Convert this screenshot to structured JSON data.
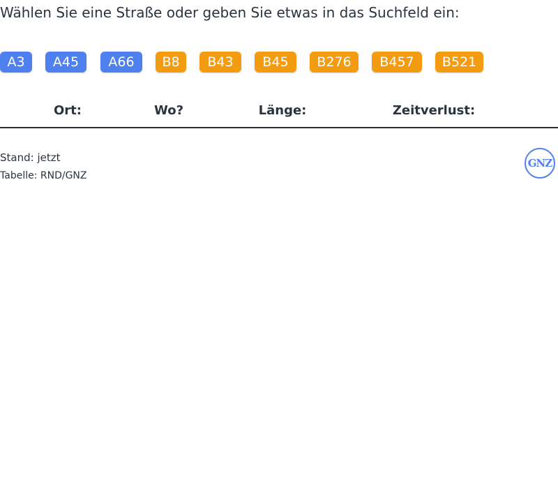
{
  "prompt": "Wählen Sie eine Straße oder geben Sie etwas in das Suchfeld ein:",
  "roads": [
    {
      "label": "A3",
      "type": "autobahn"
    },
    {
      "label": "A45",
      "type": "autobahn"
    },
    {
      "label": "A66",
      "type": "autobahn"
    },
    {
      "label": "B8",
      "type": "bundesstrasse"
    },
    {
      "label": "B43",
      "type": "bundesstrasse"
    },
    {
      "label": "B45",
      "type": "bundesstrasse"
    },
    {
      "label": "B276",
      "type": "bundesstrasse"
    },
    {
      "label": "B457",
      "type": "bundesstrasse"
    },
    {
      "label": "B521",
      "type": "bundesstrasse"
    }
  ],
  "table": {
    "columns": [
      "Ort:",
      "Wo?",
      "Länge:",
      "Zeitverlust:"
    ]
  },
  "footer": {
    "stand": "Stand: jetzt",
    "source": "Tabelle: RND/GNZ"
  },
  "logo": {
    "text": "GNZ"
  },
  "colors": {
    "autobahn": "#4f80f0",
    "bundesstrasse": "#f39c12",
    "text": "#2a3441"
  }
}
